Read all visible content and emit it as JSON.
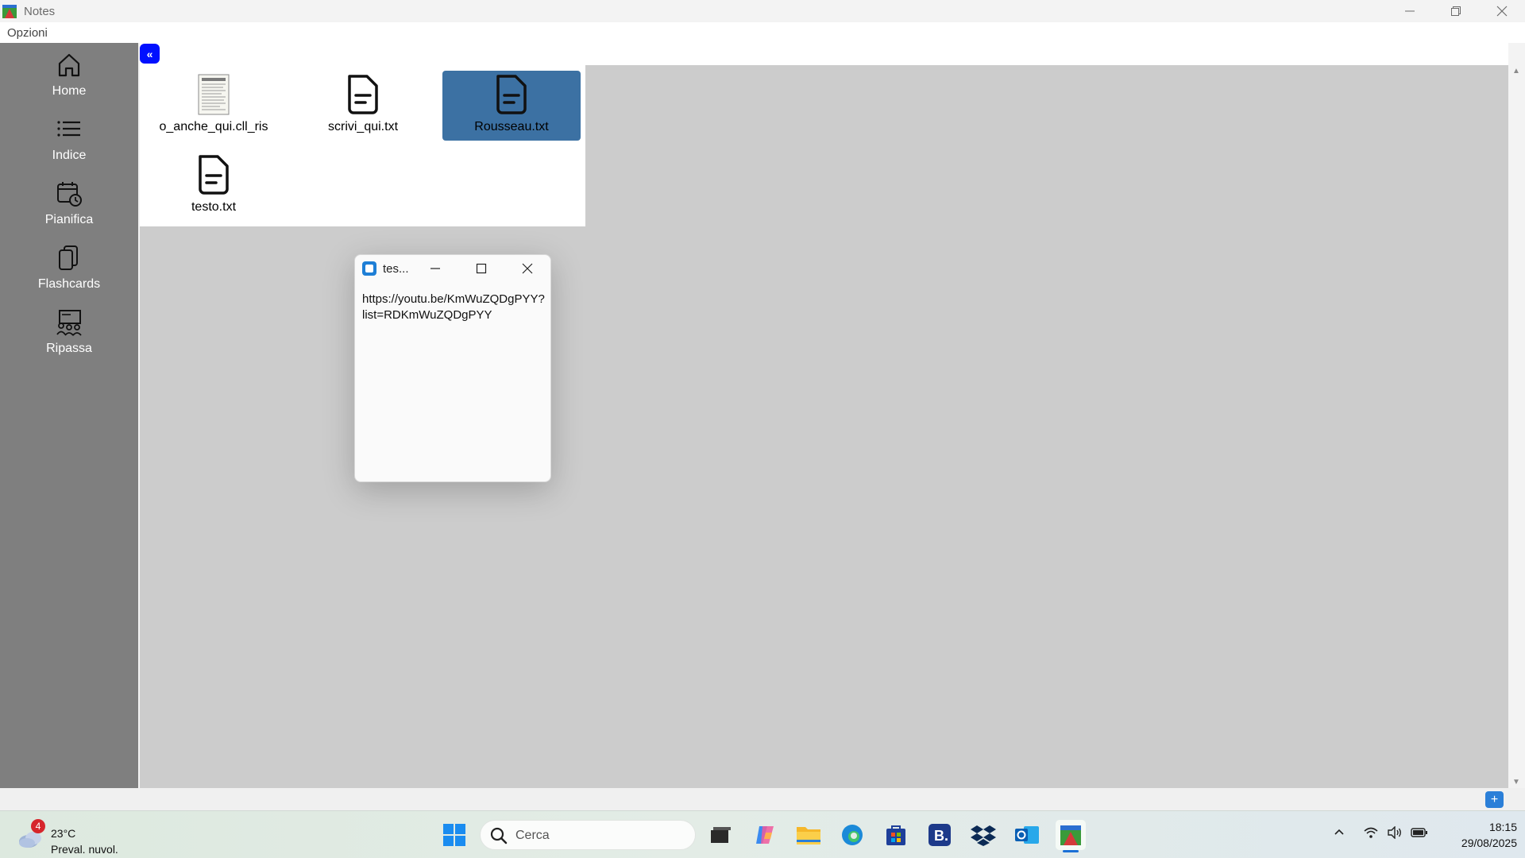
{
  "window": {
    "title": "Notes",
    "minimize": "—",
    "restore": "❐",
    "close": "✕"
  },
  "menu": {
    "options": "Opzioni"
  },
  "sidebar": {
    "items": [
      {
        "label": "Home",
        "icon": "home-icon"
      },
      {
        "label": "Indice",
        "icon": "list-icon"
      },
      {
        "label": "Pianifica",
        "icon": "calendar-clock-icon"
      },
      {
        "label": "Flashcards",
        "icon": "flashcards-icon"
      },
      {
        "label": "Ripassa",
        "icon": "review-icon"
      }
    ]
  },
  "toolbar": {
    "collapse_label": "«"
  },
  "files": [
    {
      "name": "o_anche_qui.cll_ris",
      "icon": "document-thumbnail-icon",
      "selected": false
    },
    {
      "name": "scrivi_qui.txt",
      "icon": "text-file-icon",
      "selected": false
    },
    {
      "name": "Rousseau.txt",
      "icon": "text-file-icon",
      "selected": true
    },
    {
      "name": "testo.txt",
      "icon": "text-file-icon",
      "selected": false
    }
  ],
  "popup": {
    "title": "tes...",
    "content": "https://youtu.be/KmWuZQDgPYY?list=RDKmWuZQDgPYY"
  },
  "add_button": {
    "label": "+"
  },
  "taskbar": {
    "weather": {
      "badge": "4",
      "temperature": "23°C",
      "condition": "Preval. nuvol."
    },
    "search_placeholder": "Cerca",
    "apps": [
      "windows-start-icon",
      "task-view-icon",
      "copilot-icon",
      "file-explorer-icon",
      "edge-icon",
      "store-icon",
      "booking-icon",
      "dropbox-icon",
      "outlook-icon",
      "notes-app-icon"
    ],
    "time": "18:15",
    "date": "29/08/2025"
  },
  "colors": {
    "sidebar": "#7f7f7f",
    "main_bg": "#cccccc",
    "selection": "#3c71a3",
    "collapse_button": "#0010ff",
    "add_button": "#2b7fd8"
  }
}
